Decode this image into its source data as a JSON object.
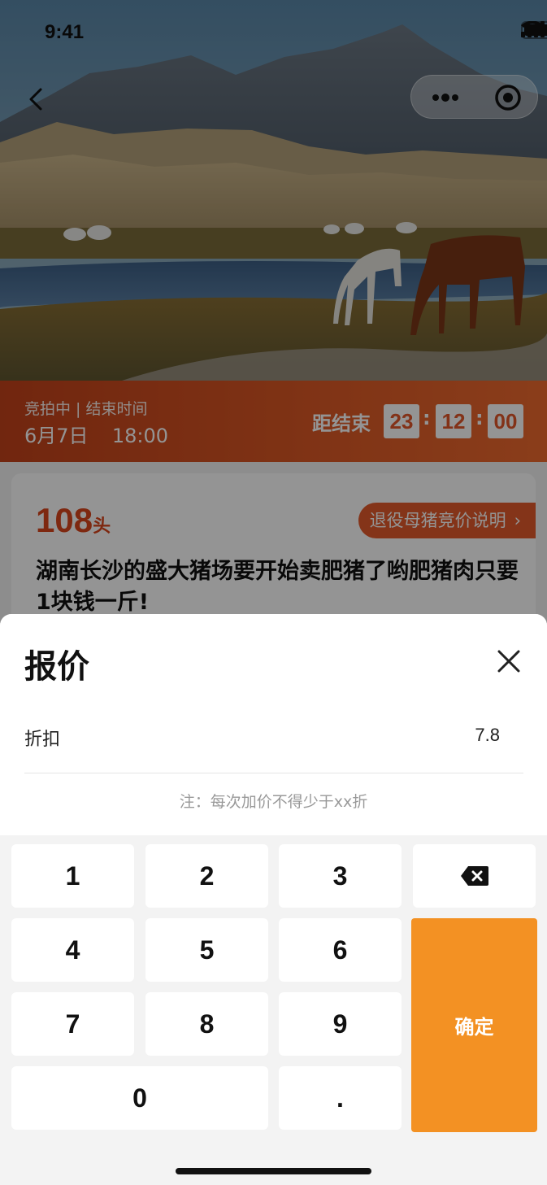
{
  "status_bar": {
    "time": "9:41"
  },
  "nav": {
    "back_icon": "chevron-left-icon",
    "more_icon": "more-dots-icon",
    "target_icon": "target-icon"
  },
  "auction": {
    "status": "竞拍中 | 结束时间",
    "end_date": "6月7日",
    "end_time": "18:00",
    "countdown_label": "距结束",
    "countdown": {
      "hours": "23",
      "minutes": "12",
      "seconds": "00"
    },
    "separator": ":"
  },
  "product": {
    "quantity": "108",
    "unit": "头",
    "rule_link": "退役母猪竞价说明",
    "title": "湖南长沙的盛大猪场要开始卖肥猪了哟肥猪肉只要1块钱一斤!"
  },
  "sheet": {
    "title": "报价",
    "field_label": "折扣",
    "field_value": "7.8",
    "note": "注：每次加价不得少于xx折"
  },
  "keypad": {
    "keys": [
      "1",
      "2",
      "3",
      "4",
      "5",
      "6",
      "7",
      "8",
      "9",
      "0",
      "."
    ],
    "confirm": "确定",
    "delete_icon": "backspace-icon"
  },
  "colors": {
    "accent": "#e35a2b",
    "auction_bar_start": "#c3421a",
    "auction_bar_end": "#ef6a2e",
    "confirm": "#f39123",
    "quantity_text": "#d9461c"
  }
}
